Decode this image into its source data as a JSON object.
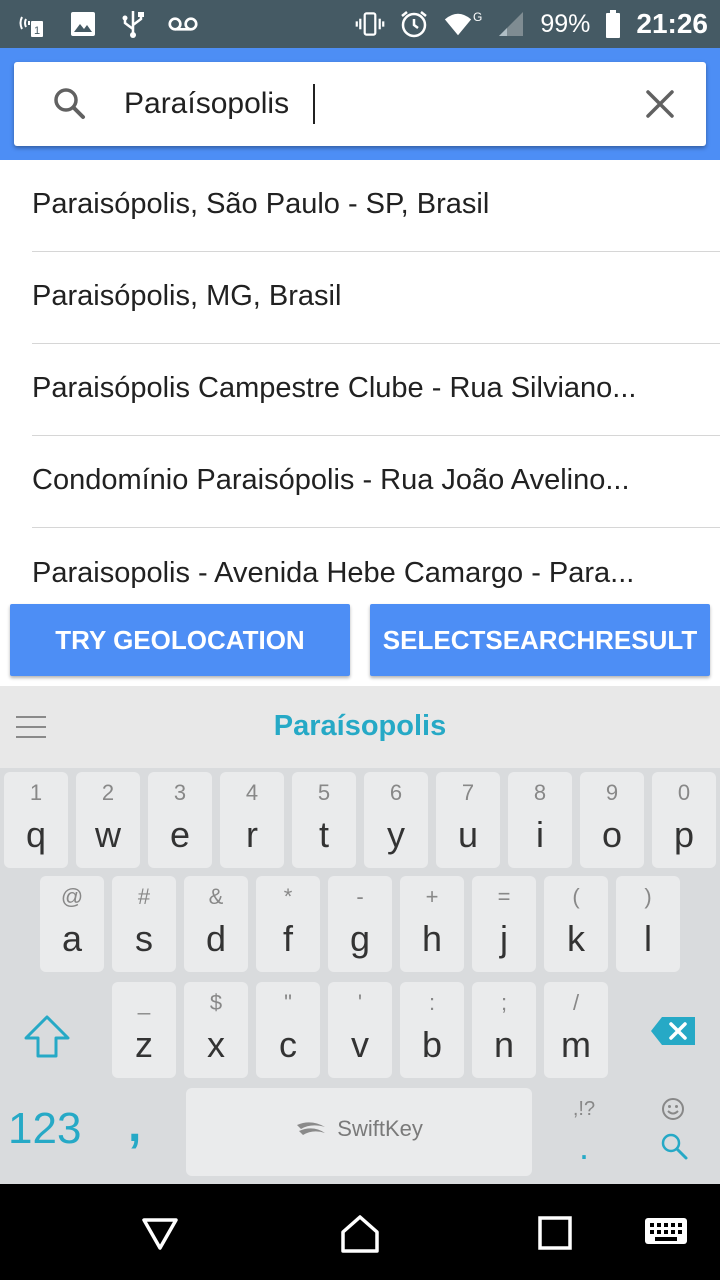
{
  "status_bar": {
    "battery_percent": "99%",
    "time": "21:26",
    "network_type": "G",
    "icons": [
      "nfc-icon",
      "image-icon",
      "usb-icon",
      "voicemail-icon",
      "vibrate-icon",
      "alarm-icon",
      "wifi-icon",
      "signal-icon",
      "battery-icon"
    ]
  },
  "search": {
    "value": "Paraísopolis"
  },
  "suggestions": [
    {
      "label": "Paraisópolis, São Paulo - SP, Brasil"
    },
    {
      "label": "Paraisópolis, MG, Brasil"
    },
    {
      "label": "Paraisópolis Campestre Clube - Rua Silviano..."
    },
    {
      "label": "Condomínio Paraisópolis - Rua João Avelino..."
    },
    {
      "label": "Paraisopolis - Avenida Hebe Camargo - Para..."
    }
  ],
  "buttons": {
    "geolocation": "TRY GEOLOCATION",
    "select_result": "SELECTSEARCHRESULT"
  },
  "keyboard": {
    "suggestion": "Paraísopolis",
    "row1": [
      {
        "hint": "1",
        "key": "q"
      },
      {
        "hint": "2",
        "key": "w"
      },
      {
        "hint": "3",
        "key": "e"
      },
      {
        "hint": "4",
        "key": "r"
      },
      {
        "hint": "5",
        "key": "t"
      },
      {
        "hint": "6",
        "key": "y"
      },
      {
        "hint": "7",
        "key": "u"
      },
      {
        "hint": "8",
        "key": "i"
      },
      {
        "hint": "9",
        "key": "o"
      },
      {
        "hint": "0",
        "key": "p"
      }
    ],
    "row2": [
      {
        "hint": "@",
        "key": "a"
      },
      {
        "hint": "#",
        "key": "s"
      },
      {
        "hint": "&",
        "key": "d"
      },
      {
        "hint": "*",
        "key": "f"
      },
      {
        "hint": "-",
        "key": "g"
      },
      {
        "hint": "+",
        "key": "h"
      },
      {
        "hint": "=",
        "key": "j"
      },
      {
        "hint": "(",
        "key": "k"
      },
      {
        "hint": ")",
        "key": "l"
      }
    ],
    "row3": [
      {
        "hint": "_",
        "key": "z"
      },
      {
        "hint": "$",
        "key": "x"
      },
      {
        "hint": "\"",
        "key": "c"
      },
      {
        "hint": "'",
        "key": "v"
      },
      {
        "hint": ":",
        "key": "b"
      },
      {
        "hint": ";",
        "key": "n"
      },
      {
        "hint": "/",
        "key": "m"
      }
    ],
    "num_key": "123",
    "comma_key": ",",
    "space_label": "SwiftKey",
    "period_hint": ",!?",
    "period_key": "."
  },
  "colors": {
    "accent": "#4d8ef5",
    "keyboard_accent": "#26a9c6",
    "status_bar": "#455a64"
  }
}
